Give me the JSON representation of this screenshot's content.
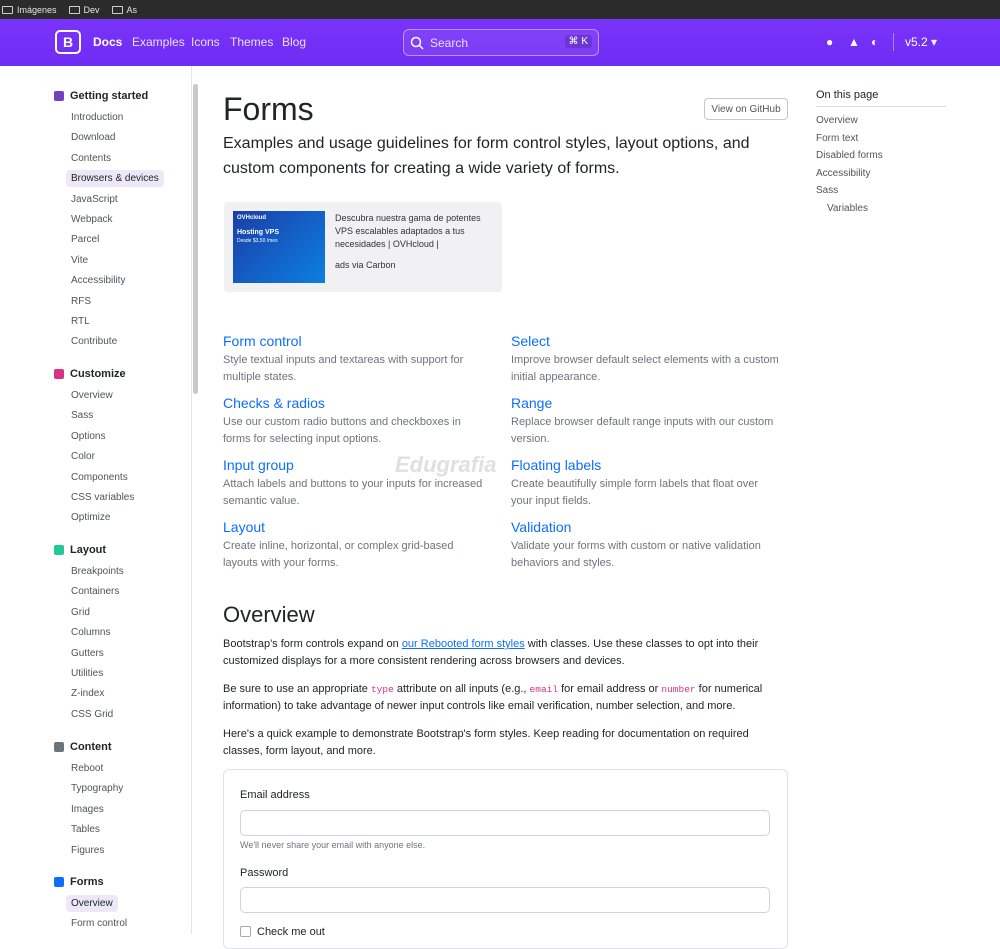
{
  "bookmarks": [
    "Imágenes",
    "Dev",
    "As"
  ],
  "nav": {
    "brand": "Docs",
    "links": [
      "Examples",
      "Icons",
      "Themes",
      "Blog"
    ],
    "search_placeholder": "Search",
    "search_kbd": "⌘ K",
    "version": "v5.2"
  },
  "sidebar": {
    "groups": [
      {
        "label": "Getting started",
        "color": "#6f42c1",
        "items": [
          "Introduction",
          "Download",
          "Contents",
          "Browsers & devices",
          "JavaScript",
          "Webpack",
          "Parcel",
          "Vite",
          "Accessibility",
          "RFS",
          "RTL",
          "Contribute"
        ]
      },
      {
        "label": "Customize",
        "color": "#d63384",
        "items": [
          "Overview",
          "Sass",
          "Options",
          "Color",
          "Components",
          "CSS variables",
          "Optimize"
        ]
      },
      {
        "label": "Layout",
        "color": "#20c997",
        "items": [
          "Breakpoints",
          "Containers",
          "Grid",
          "Columns",
          "Gutters",
          "Utilities",
          "Z-index",
          "CSS Grid"
        ]
      },
      {
        "label": "Content",
        "color": "#6c757d",
        "items": [
          "Reboot",
          "Typography",
          "Images",
          "Tables",
          "Figures"
        ]
      },
      {
        "label": "Forms",
        "color": "#0d6efd",
        "items": [
          "Overview",
          "Form control"
        ]
      }
    ],
    "active": [
      "Browsers & devices",
      "Overview"
    ]
  },
  "page": {
    "title": "Forms",
    "github_button": "View on GitHub",
    "lead": "Examples and usage guidelines for form control styles, layout options, and custom components for creating a wide variety of forms.",
    "ad": {
      "image_brand": "OVHcloud",
      "image_line1": "Hosting VPS",
      "image_line2": "Desde $3,50 /mes",
      "text": "Descubra nuestra gama de potentes VPS escalables adaptados a tus necesidades | OVHcloud |",
      "via": "ads via Carbon"
    },
    "cards": [
      {
        "title": "Form control",
        "text": "Style textual inputs and textareas with support for multiple states."
      },
      {
        "title": "Select",
        "text": "Improve browser default select elements with a custom initial appearance."
      },
      {
        "title": "Checks & radios",
        "text": "Use our custom radio buttons and checkboxes in forms for selecting input options."
      },
      {
        "title": "Range",
        "text": "Replace browser default range inputs with our custom version."
      },
      {
        "title": "Input group",
        "text": "Attach labels and buttons to your inputs for increased semantic value."
      },
      {
        "title": "Floating labels",
        "text": "Create beautifully simple form labels that float over your input fields."
      },
      {
        "title": "Layout",
        "text": "Create inline, horizontal, or complex grid-based layouts with your forms."
      },
      {
        "title": "Validation",
        "text": "Validate your forms with custom or native validation behaviors and styles."
      }
    ],
    "overview_title": "Overview",
    "p1_a": "Bootstrap's form controls expand on ",
    "p1_link": "our Rebooted form styles",
    "p1_b": " with classes. Use these classes to opt into their customized displays for a more consistent rendering across browsers and devices.",
    "p2_a": "Be sure to use an appropriate ",
    "p2_code1": "type",
    "p2_b": " attribute on all inputs (e.g., ",
    "p2_code2": "email",
    "p2_c": " for email address or ",
    "p2_code3": "number",
    "p2_d": " for numerical information) to take advantage of newer input controls like email verification, number selection, and more.",
    "p3": "Here's a quick example to demonstrate Bootstrap's form styles. Keep reading for documentation on required classes, form layout, and more.",
    "example": {
      "email_label": "Email address",
      "email_help": "We'll never share your email with anyone else.",
      "password_label": "Password",
      "check_label": "Check me out"
    }
  },
  "toc": {
    "title": "On this page",
    "items": [
      "Overview",
      "Form text",
      "Disabled forms",
      "Accessibility",
      "Sass",
      "Variables"
    ]
  },
  "watermark": "Edugrafia"
}
